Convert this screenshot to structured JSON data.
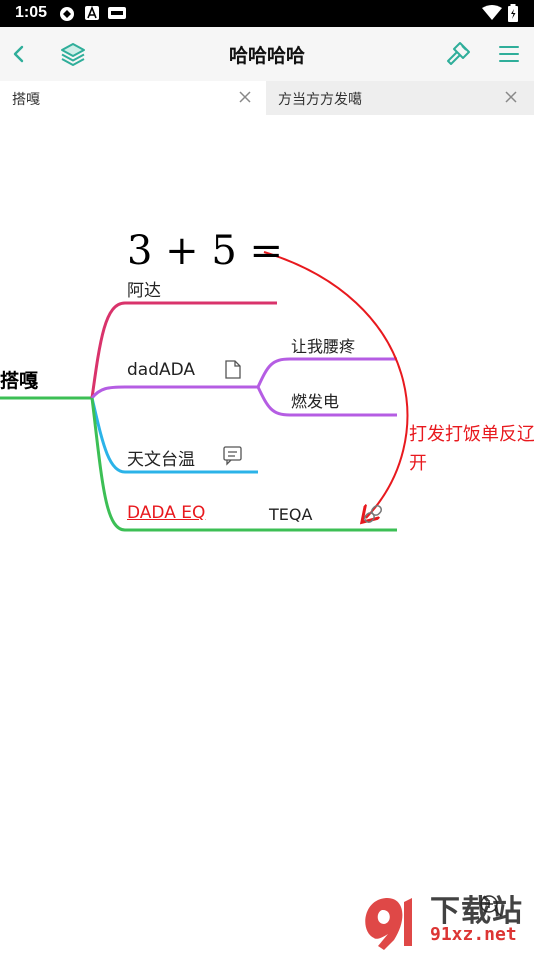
{
  "status_bar": {
    "time": "1:05"
  },
  "app_bar": {
    "title": "哈哈哈哈"
  },
  "tabs": [
    {
      "label": "搭嘎",
      "active": true
    },
    {
      "label": "方当方方发噶",
      "active": false
    }
  ],
  "mindmap": {
    "root": "搭嘎",
    "formula": "3 + 5 =",
    "branches": [
      {
        "label": "阿达",
        "color": "#d9336b"
      },
      {
        "label": "dadADA",
        "color": "#b55de3",
        "has_note_icon": true,
        "children": [
          {
            "label": "让我腰疼"
          },
          {
            "label": "燃发电"
          }
        ]
      },
      {
        "label": "天文台温",
        "color": "#2bb3e8",
        "has_comment_icon": true
      },
      {
        "label": "DADA EQ",
        "color": "#3cbf55",
        "link_color": "#e8191e",
        "children": [
          {
            "label": "TEQA",
            "has_link_icon": true
          }
        ]
      }
    ],
    "root_line_color": "#3cbf55",
    "relationship": {
      "label": "打发打饭单反辽开",
      "color": "#e8191e"
    }
  },
  "watermark": {
    "text": "下载站",
    "domain": "91xz.net"
  },
  "colors": {
    "accent": "#2fae9a"
  }
}
